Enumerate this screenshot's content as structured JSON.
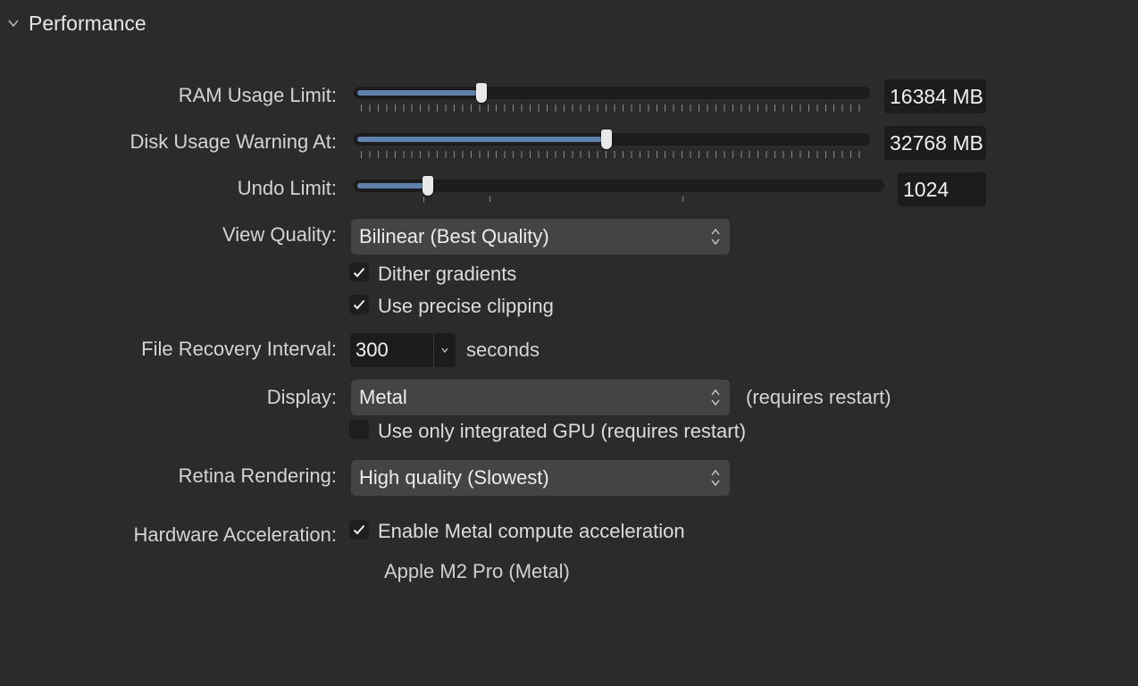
{
  "section": {
    "title": "Performance"
  },
  "ram": {
    "label": "RAM Usage Limit:",
    "value": "16384 MB",
    "level": 0.24
  },
  "disk": {
    "label": "Disk Usage Warning At:",
    "value": "32768 MB",
    "level": 0.49
  },
  "undo": {
    "label": "Undo Limit:",
    "value": "1024",
    "level": 0.13
  },
  "view_quality": {
    "label": "View Quality:",
    "selected": "Bilinear (Best Quality)",
    "dither": {
      "label": "Dither gradients",
      "checked": true
    },
    "precise_clipping": {
      "label": "Use precise clipping",
      "checked": true
    }
  },
  "file_recovery": {
    "label": "File Recovery Interval:",
    "value": "300",
    "unit": "seconds"
  },
  "display": {
    "label": "Display:",
    "selected": "Metal",
    "note": "(requires restart)",
    "integrated_gpu": {
      "label": "Use only integrated GPU (requires restart)",
      "checked": false
    }
  },
  "retina": {
    "label": "Retina Rendering:",
    "selected": "High quality (Slowest)"
  },
  "hardware": {
    "label": "Hardware Acceleration:",
    "metal_compute": {
      "label": "Enable Metal compute acceleration",
      "checked": true
    },
    "device": "Apple M2 Pro (Metal)"
  },
  "colors": {
    "accent": "#5f82ad",
    "background": "#2b2b2b",
    "field": "#1c1c1c",
    "popup": "#444444"
  }
}
